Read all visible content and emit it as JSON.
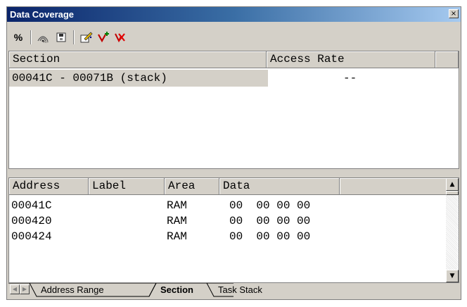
{
  "window": {
    "title": "Data Coverage",
    "close_glyph": "×"
  },
  "toolbar": {
    "buttons": [
      {
        "name": "percent-button",
        "glyph": "%",
        "icon": "percent-icon"
      },
      {
        "name": "radar-button",
        "glyph": "⌘",
        "icon": "coverage-icon"
      },
      {
        "name": "save-button",
        "glyph": "▣",
        "icon": "disk-icon"
      },
      {
        "name": "edit-button",
        "glyph": "✎",
        "icon": "pencil-icon"
      },
      {
        "name": "add-range-button",
        "glyph": "✚",
        "icon": "add-icon"
      },
      {
        "name": "delete-range-button",
        "glyph": "✕",
        "icon": "delete-icon"
      }
    ]
  },
  "section_table": {
    "headers": [
      "Section",
      "Access Rate"
    ],
    "rows": [
      {
        "section": "00041C - 00071B (stack)",
        "access_rate": "--"
      }
    ]
  },
  "data_table": {
    "headers": [
      "Address",
      "Label",
      "Area",
      "Data"
    ],
    "rows": [
      {
        "address": "00041C",
        "label": "",
        "area": "RAM",
        "data": "00  00 00 00"
      },
      {
        "address": "000420",
        "label": "",
        "area": "RAM",
        "data": "00  00 00 00"
      },
      {
        "address": "000424",
        "label": "",
        "area": "RAM",
        "data": "00  00 00 00"
      }
    ]
  },
  "tabs": {
    "items": [
      "Address Range",
      "Section",
      "Task Stack"
    ],
    "active": "Section",
    "prev_glyph": "◀",
    "next_glyph": "▶"
  },
  "scrollbar": {
    "up_glyph": "▲",
    "down_glyph": "▼"
  }
}
